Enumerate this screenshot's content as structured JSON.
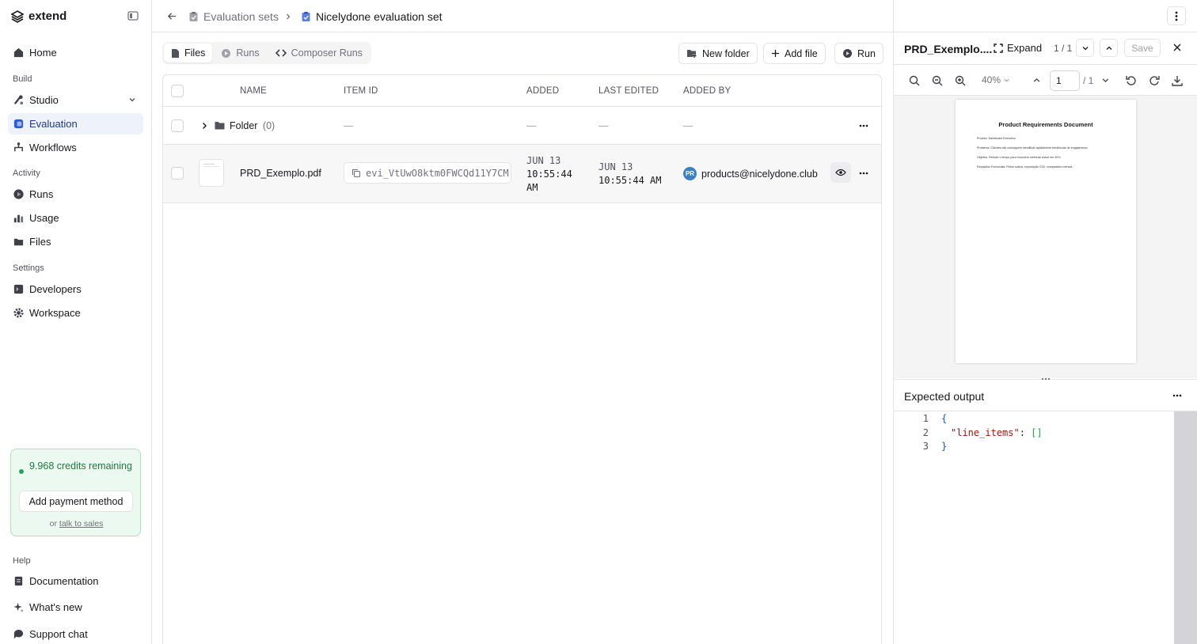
{
  "app": {
    "name": "extend"
  },
  "sidebar": {
    "home": "Home",
    "section_build": "Build",
    "studio": "Studio",
    "evaluation": "Evaluation",
    "workflows": "Workflows",
    "section_activity": "Activity",
    "runs": "Runs",
    "usage": "Usage",
    "files": "Files",
    "section_settings": "Settings",
    "developers": "Developers",
    "workspace": "Workspace",
    "credits_text": "9.968 credits remaining",
    "payment_button": "Add payment method",
    "sales_prefix": "or",
    "sales_link": "talk to sales",
    "section_help": "Help",
    "documentation": "Documentation",
    "whats_new": "What's new",
    "support_chat": "Support chat"
  },
  "breadcrumb": {
    "parent": "Evaluation sets",
    "current": "Nicelydone evaluation set"
  },
  "tabs": [
    "Files",
    "Runs",
    "Composer Runs"
  ],
  "toolbar": {
    "new_folder": "New folder",
    "add_file": "Add file",
    "run": "Run"
  },
  "table": {
    "headers": {
      "name": "NAME",
      "item_id": "ITEM ID",
      "added": "ADDED",
      "last_edited": "LAST EDITED",
      "added_by": "ADDED BY"
    },
    "folder": {
      "name": "Folder",
      "count": "(0)",
      "dash": "—"
    },
    "file": {
      "name": "PRD_Exemplo.pdf",
      "item_id": "evi_VtUwO8ktm0FWCQd11Y7CM",
      "added_date": "JUN 13",
      "added_time": "10:55:44",
      "added_ampm": "AM",
      "edited_date": "JUN 13",
      "edited_time": "10:55:44 AM",
      "avatar_initials": "PR",
      "added_by": "products@nicelydone.club"
    }
  },
  "panel": {
    "title": "PRD_Exemplo....",
    "expand": "Expand",
    "page_counter": "1 / 1",
    "save": "Save",
    "zoom": "40%",
    "page_input": "1",
    "page_total": "/ 1",
    "document": {
      "title": "Product Requirements Document",
      "lines": [
        "Produto: Dashboard Executivo",
        "Problema: Clientes não conseguem identificar rapidamente tendências de engajamento.",
        "Objetivo: Reduzir o tempo para encontrar métricas-chave em 30%.",
        "Requisitos Funcionais: Filtros salvos, exportação CSV, comparativo mensal."
      ]
    },
    "expected_output_label": "Expected output",
    "code_lines": [
      {
        "n": "1",
        "text": "{"
      },
      {
        "n": "2",
        "key": "\"line_items\"",
        "colon": ": ",
        "value": "[]"
      },
      {
        "n": "3",
        "text": "}"
      }
    ]
  }
}
